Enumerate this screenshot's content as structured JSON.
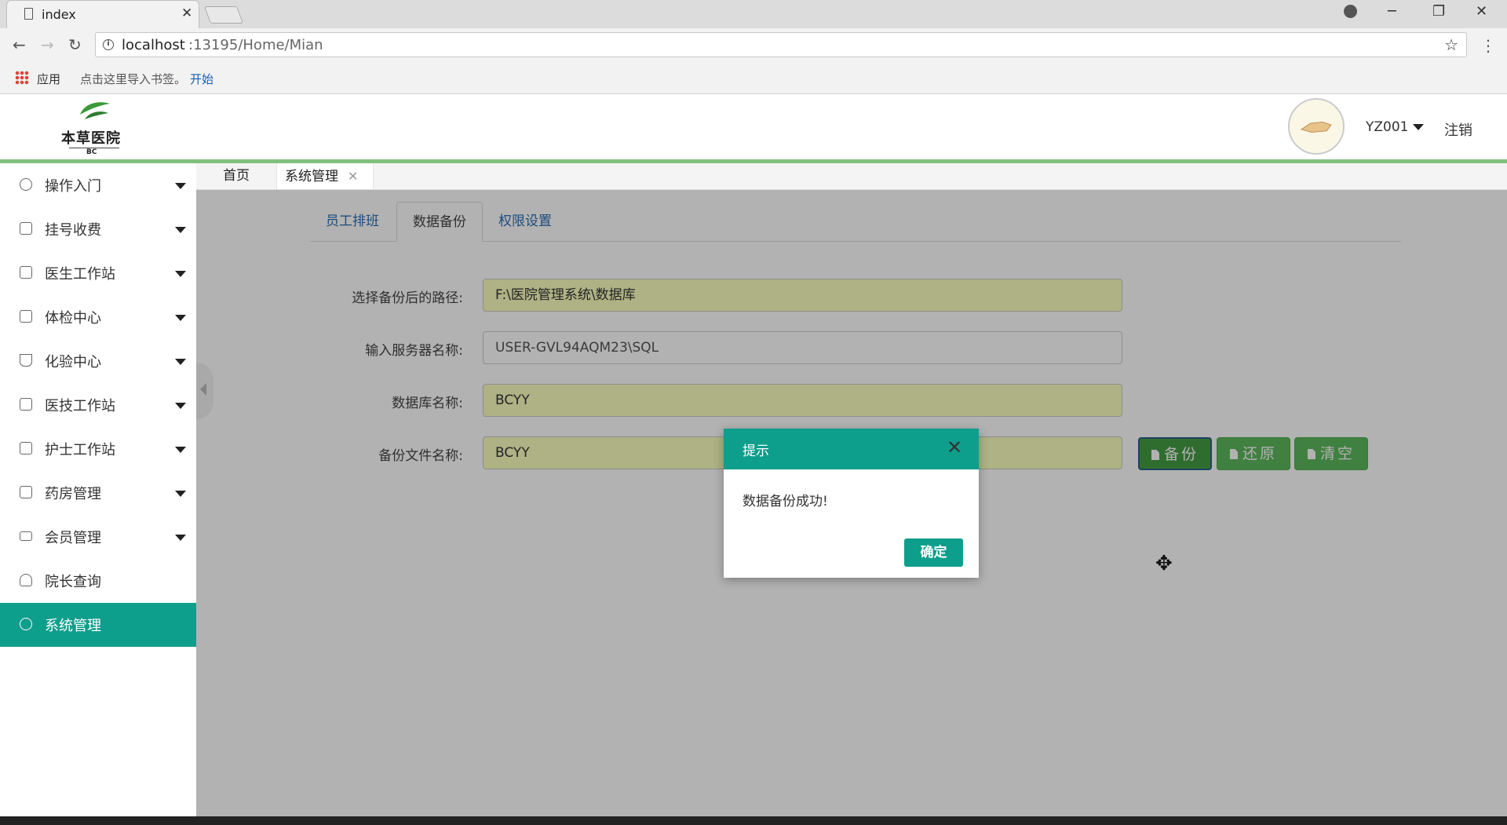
{
  "browser": {
    "tab_title": "index",
    "tab_close": "✕",
    "url_host": "localhost",
    "url_rest": ":13195/Home/Mian",
    "bookmarks_apps": "应用",
    "bookmarks_hint": "点击这里导入书签。",
    "bookmarks_start": "开始",
    "controls": {
      "minimize": "─",
      "restore": "❐",
      "close": "✕"
    }
  },
  "header": {
    "logo_name": "本草医院",
    "logo_sub": "BC",
    "user_name": "YZ001",
    "logout_label": "注销"
  },
  "sidebar": {
    "items": [
      {
        "label": "操作入门",
        "icon": "gear-icon"
      },
      {
        "label": "挂号收费",
        "icon": "edit-icon"
      },
      {
        "label": "医生工作站",
        "icon": "document-icon"
      },
      {
        "label": "体检中心",
        "icon": "medical-kit-icon"
      },
      {
        "label": "化验中心",
        "icon": "flask-icon"
      },
      {
        "label": "医技工作站",
        "icon": "list-icon"
      },
      {
        "label": "护士工作站",
        "icon": "medical-kit-icon"
      },
      {
        "label": "药房管理",
        "icon": "pill-bottle-icon"
      },
      {
        "label": "会员管理",
        "icon": "card-icon"
      },
      {
        "label": "院长查询",
        "icon": "user-icon"
      },
      {
        "label": "系统管理",
        "icon": "tools-icon"
      }
    ]
  },
  "page_tabs": {
    "home": "首页",
    "system": "系统管理",
    "close": "✕"
  },
  "inner_tabs": {
    "schedule": "员工排班",
    "backup": "数据备份",
    "permissions": "权限设置"
  },
  "form": {
    "path_label": "选择备份后的路径:",
    "path_value": "F:\\医院管理系统\\数据库",
    "server_label": "输入服务器名称:",
    "server_value": "USER-GVL94AQM23\\SQL",
    "db_label": "数据库名称:",
    "db_value": "BCYY",
    "file_label": "备份文件名称:",
    "file_value": "BCYY"
  },
  "buttons": {
    "backup": "备份",
    "restore": "还原",
    "clear": "清空"
  },
  "modal": {
    "title": "提示",
    "close": "✕",
    "message": "数据备份成功!",
    "ok": "确定"
  },
  "colors": {
    "accent": "#0e9e8c",
    "button_green": "#5cb85c",
    "autofill": "#faffbd",
    "header_line": "#7fc27d"
  }
}
